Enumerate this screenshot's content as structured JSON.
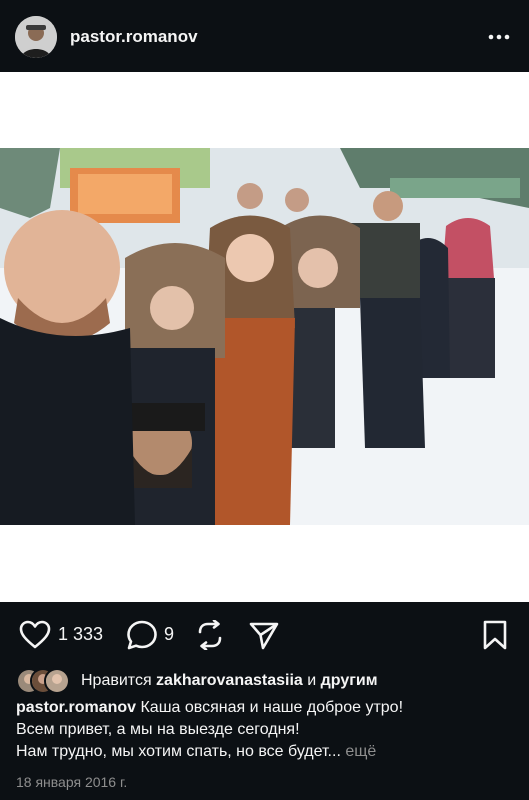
{
  "header": {
    "username": "pastor.romanov",
    "avatar_icon": "user-avatar",
    "more_icon": "more-horizontal-icon"
  },
  "post": {
    "photo_description_icon": "group-photo"
  },
  "actions": {
    "likes_count": "1 333",
    "comments_count": "9",
    "like_icon": "heart-icon",
    "comment_icon": "comment-icon",
    "repost_icon": "repost-icon",
    "share_icon": "send-icon",
    "save_icon": "bookmark-icon"
  },
  "likes": {
    "prefix": "Нравится ",
    "user": "zakharovanastasiia",
    "middle": " и ",
    "others": "другим"
  },
  "caption": {
    "username": "pastor.romanov",
    "line1": " Каша овсяная и наше доброе утро!",
    "line2": "Всем привет, а мы на выезде сегодня!",
    "line3": "Нам трудно, мы хотим спать, но все будет...",
    "more": " ещё"
  },
  "date": "18 января 2016 г.",
  "colors": {
    "background": "#0c1014",
    "text": "#f5f5f5",
    "muted": "#8e8e8e",
    "frame": "#ffffff"
  }
}
